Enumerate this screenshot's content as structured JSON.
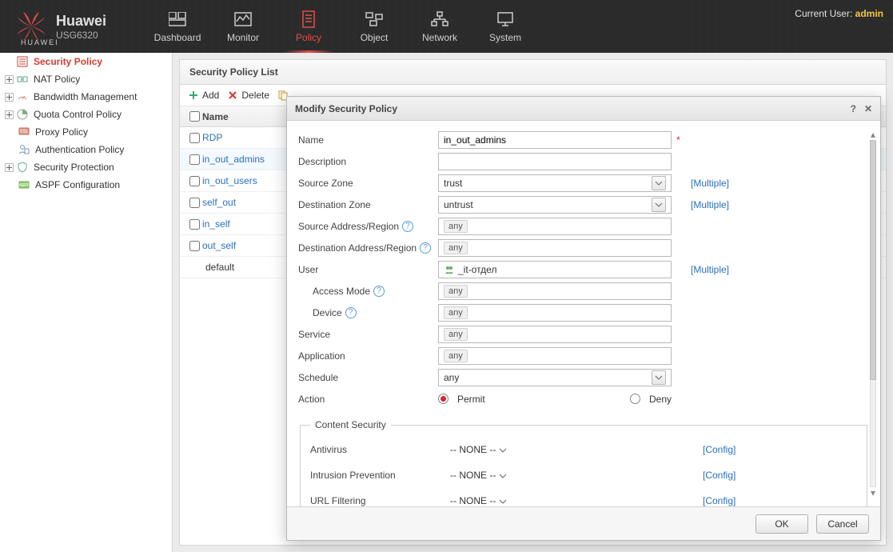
{
  "header": {
    "brand_name": "Huawei",
    "brand_model": "USG6320",
    "brand_sub": "HUAWEI",
    "current_user_label": "Current User:",
    "current_user_name": "admin",
    "nav": [
      {
        "label": "Dashboard"
      },
      {
        "label": "Monitor"
      },
      {
        "label": "Policy"
      },
      {
        "label": "Object"
      },
      {
        "label": "Network"
      },
      {
        "label": "System"
      }
    ]
  },
  "sidebar": {
    "items": [
      {
        "label": "Security Policy",
        "active": true
      },
      {
        "label": "NAT Policy"
      },
      {
        "label": "Bandwidth Management"
      },
      {
        "label": "Quota Control Policy"
      },
      {
        "label": "Proxy Policy"
      },
      {
        "label": "Authentication Policy"
      },
      {
        "label": "Security Protection"
      },
      {
        "label": "ASPF Configuration"
      }
    ]
  },
  "main": {
    "title": "Security Policy List",
    "toolbar": {
      "add_label": "Add",
      "delete_label": "Delete"
    },
    "table": {
      "col_name": "Name",
      "rows": [
        {
          "name": "RDP"
        },
        {
          "name": "in_out_admins",
          "selected": true
        },
        {
          "name": "in_out_users"
        },
        {
          "name": "self_out"
        },
        {
          "name": "in_self"
        },
        {
          "name": "out_self"
        },
        {
          "name": "default",
          "plain": true
        }
      ]
    }
  },
  "modal": {
    "title": "Modify Security Policy",
    "fields": {
      "name_label": "Name",
      "name_value": "in_out_admins",
      "description_label": "Description",
      "description_value": "",
      "src_zone_label": "Source Zone",
      "src_zone_value": "trust",
      "dst_zone_label": "Destination Zone",
      "dst_zone_value": "untrust",
      "src_addr_label": "Source Address/Region",
      "src_addr_value": "any",
      "dst_addr_label": "Destination Address/Region",
      "dst_addr_value": "any",
      "user_label": "User",
      "user_value": "_it-отдел",
      "access_mode_label": "Access Mode",
      "access_mode_value": "any",
      "device_label": "Device",
      "device_value": "any",
      "service_label": "Service",
      "service_value": "any",
      "application_label": "Application",
      "application_value": "any",
      "schedule_label": "Schedule",
      "schedule_value": "any",
      "action_label": "Action",
      "action_permit": "Permit",
      "action_deny": "Deny",
      "multiple_link": "[Multiple]",
      "config_link": "[Config]"
    },
    "content_security": {
      "legend": "Content Security",
      "antivirus_label": "Antivirus",
      "antivirus_value": "-- NONE --",
      "ips_label": "Intrusion Prevention",
      "ips_value": "-- NONE --",
      "url_label": "URL Filtering",
      "url_value": "-- NONE --"
    },
    "buttons": {
      "ok": "OK",
      "cancel": "Cancel"
    }
  }
}
